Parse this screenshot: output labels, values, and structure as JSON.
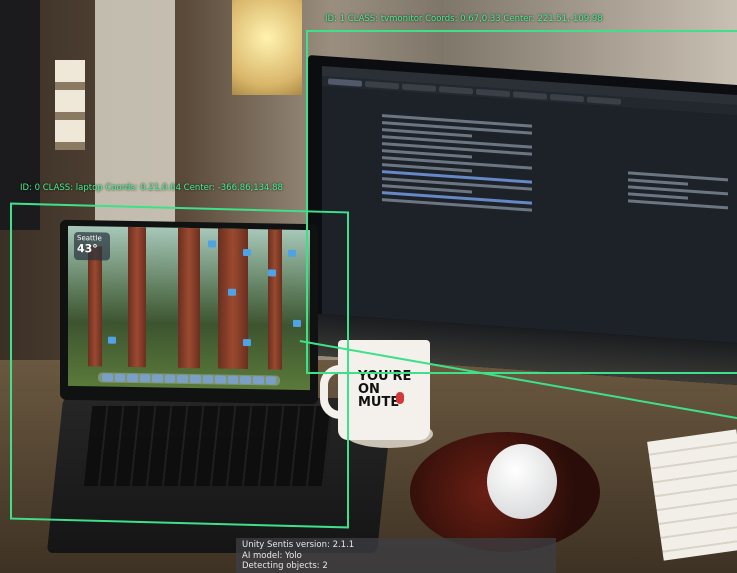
{
  "detections": [
    {
      "label_text": "ID: 0 CLASS: laptop Coords: 0.21,0.64 Center: -366.86,134.88",
      "id": 0,
      "class": "laptop",
      "coords": "0.21,0.64",
      "center": "-366.86,134.88"
    },
    {
      "label_text": "ID: 1 CLASS: tvmonitor Coords: 0.67,0.33 Center: 221.51,-109.98",
      "id": 1,
      "class": "tvmonitor",
      "coords": "0.67,0.33",
      "center": "221.51,-109.98"
    }
  ],
  "info_panel": {
    "version": "Unity Sentis version: 2.1.1",
    "model": "AI model: Yolo",
    "count": "Detecting objects: 2"
  },
  "mug": {
    "text_line1": "YOU'RE",
    "text_line2": "ON",
    "text_line3": "MUTE"
  },
  "laptop_widget": {
    "city": "Seattle",
    "temp": "43°"
  },
  "colors": {
    "bbox": "#3ee08a",
    "label": "#47f08f"
  }
}
